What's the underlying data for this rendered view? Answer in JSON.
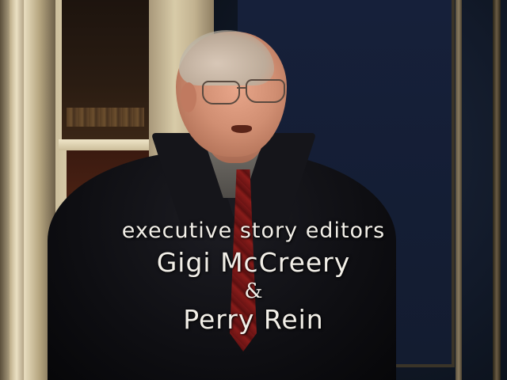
{
  "credits": {
    "role": "executive story editors",
    "name_1": "Gigi McCreery",
    "conjunction": "&",
    "name_2": "Perry Rein"
  },
  "colors": {
    "credit_text": "#f2efe8",
    "background_wall": "#131c30",
    "coat": "#0e0e12",
    "tie": "#7a1818"
  }
}
